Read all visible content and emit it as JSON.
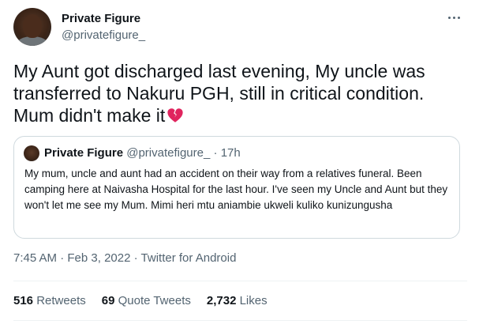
{
  "author": {
    "name": "Private Figure",
    "handle": "@privatefigure_"
  },
  "tweet": {
    "text": "My Aunt got discharged last evening, My uncle was transferred to Nakuru PGH, still in critical condition. Mum didn't make it",
    "emoji": "broken-heart-icon"
  },
  "quoted_tweet": {
    "name": "Private Figure",
    "handle": "@privatefigure_",
    "separator": "·",
    "time": "17h",
    "text": "My mum, uncle and aunt had an accident on their way from a relatives funeral. Been camping here at Naivasha Hospital for the last hour. I've seen my Uncle and Aunt but they won't let me see my Mum. Mimi heri mtu aniambie ukweli kuliko kunizungusha"
  },
  "meta": {
    "time": "7:45 AM",
    "date": "Feb 3, 2022",
    "separator": "·",
    "source": "Twitter for Android"
  },
  "stats": {
    "retweets_count": "516",
    "retweets_label": "Retweets",
    "quotes_count": "69",
    "quotes_label": "Quote Tweets",
    "likes_count": "2,732",
    "likes_label": "Likes"
  },
  "colors": {
    "text": "#0f1419",
    "secondary": "#536471",
    "border": "#cfd9de",
    "heart": "#e0245e"
  }
}
